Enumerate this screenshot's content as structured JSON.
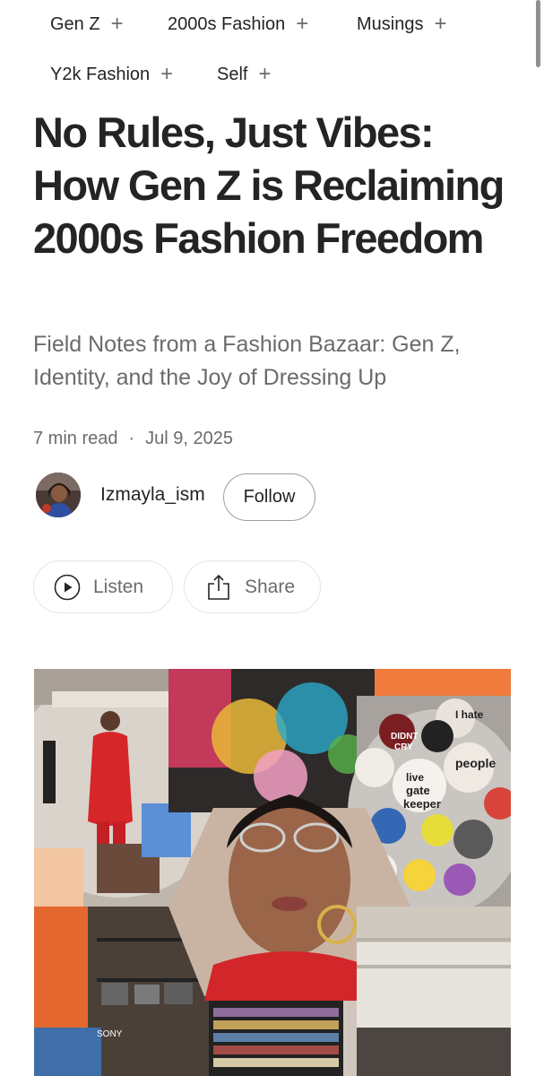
{
  "tags": [
    {
      "label": "Gen Z"
    },
    {
      "label": "2000s Fashion"
    },
    {
      "label": "Musings"
    },
    {
      "label": "Y2k Fashion"
    },
    {
      "label": "Self"
    }
  ],
  "tag_plus": "+",
  "article": {
    "title": "No Rules, Just Vibes: How Gen Z is Reclaiming 2000s Fashion Freedom",
    "subtitle": "Field Notes from a Fashion Bazaar: Gen Z, Identity, and the Joy of Dressing Up",
    "read_time": "7 min read",
    "separator": "·",
    "date": "Jul 9, 2025"
  },
  "author": {
    "name": "Izmayla_ism",
    "follow_label": "Follow"
  },
  "actions": {
    "listen_label": "Listen",
    "share_label": "Share"
  },
  "hero_image": {
    "collage_text": [
      "DIDNT",
      "CRY",
      "I hate",
      "people",
      "live",
      "gate",
      "keeper",
      "SONY"
    ]
  },
  "colors": {
    "text": "#242424",
    "muted": "#6b6b6b",
    "border": "#e5e5e5"
  }
}
